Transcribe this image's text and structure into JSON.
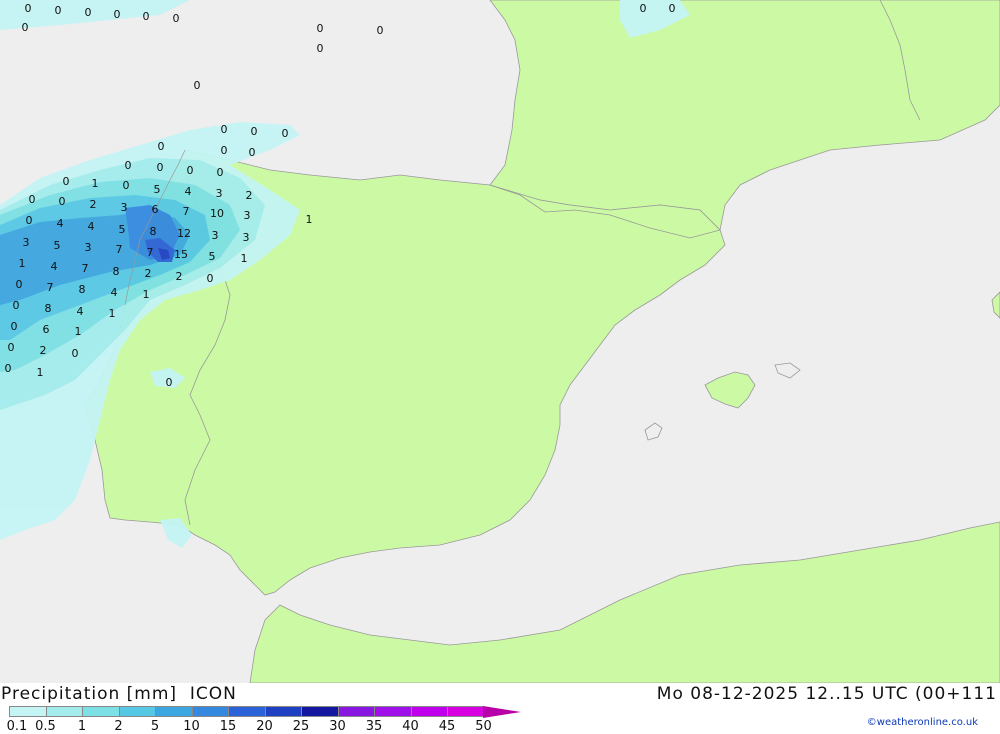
{
  "header": {
    "left_title": "Precipitation [mm]  ICON",
    "right_title": "Mo 08-12-2025 12..15 UTC (00+111",
    "credit": "©weatheronline.co.uk"
  },
  "legend": {
    "labels": [
      "0.1",
      "0.5",
      "1",
      "2",
      "5",
      "10",
      "15",
      "20",
      "25",
      "30",
      "35",
      "40",
      "45",
      "50"
    ],
    "colors": [
      "#c4f4f4",
      "#a4ecec",
      "#7ce0e4",
      "#56c8e4",
      "#3ca6e0",
      "#3488e0",
      "#2c62d8",
      "#2040c4",
      "#1418a0",
      "#8818e0",
      "#a010e8",
      "#c000ec",
      "#d800e0",
      "#b800a8"
    ]
  },
  "colors": {
    "sea": "#eeeeee",
    "land": "#ccfaa4",
    "border": "#999999"
  },
  "map": {
    "values": [
      "0",
      "0",
      "0",
      "0",
      "0",
      "0",
      "0",
      "0",
      "0",
      "0",
      "0",
      "0",
      "0",
      "0",
      "0",
      "0",
      "0",
      "0",
      "0",
      "0",
      "1",
      "0",
      "5",
      "4",
      "3",
      "2",
      "0",
      "0",
      "2",
      "3",
      "6",
      "7",
      "10",
      "3",
      "1",
      "0",
      "4",
      "4",
      "5",
      "8",
      "12",
      "3",
      "3",
      "3",
      "5",
      "3",
      "7",
      "7",
      "15",
      "5",
      "1",
      "1",
      "4",
      "7",
      "8",
      "2",
      "2",
      "0",
      "0",
      "7",
      "8",
      "4",
      "1",
      "0",
      "8",
      "4",
      "1",
      "0",
      "6",
      "1",
      "0",
      "2",
      "0",
      "0",
      "1",
      "0",
      "0",
      "0",
      "0",
      "0",
      "0",
      "0",
      "0"
    ]
  }
}
